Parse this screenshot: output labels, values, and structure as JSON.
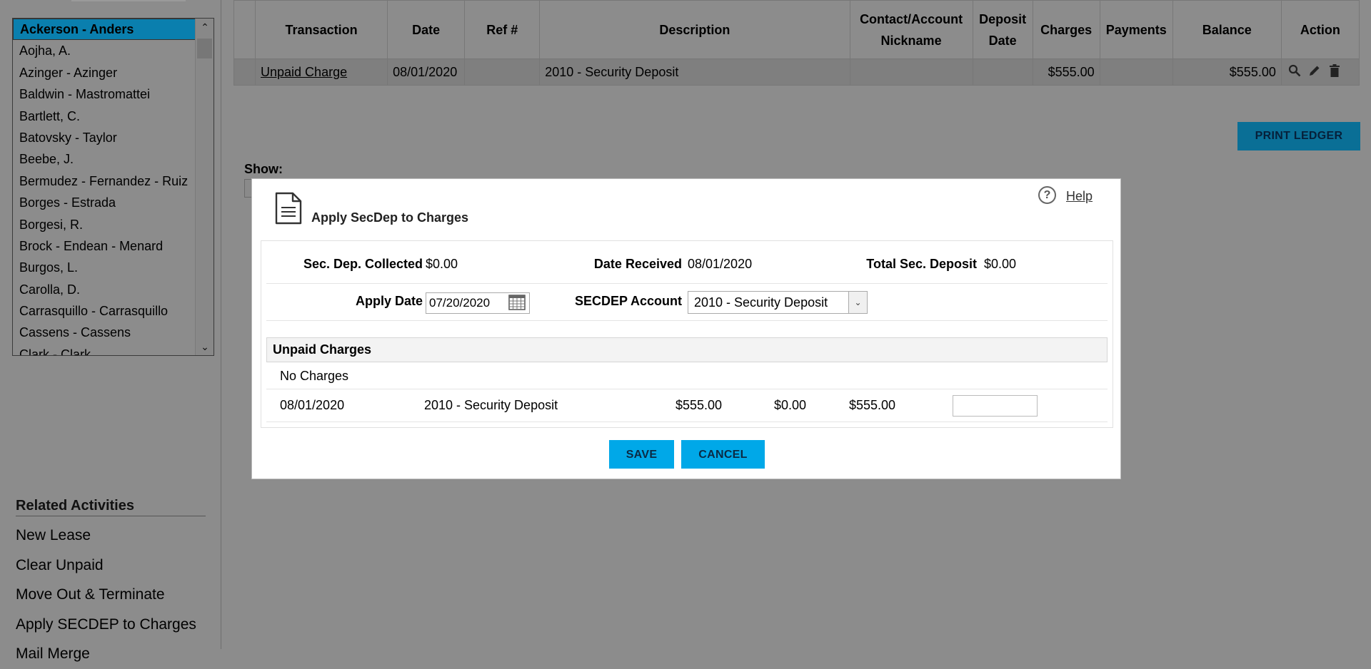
{
  "sidebar": {
    "tenants": [
      "Ackerson - Anders",
      "Aojha, A.",
      "Azinger - Azinger",
      "Baldwin - Mastromattei",
      "Bartlett, C.",
      "Batovsky - Taylor",
      "Beebe, J.",
      "Bermudez - Fernandez - Ruiz",
      "Borges - Estrada",
      "Borgesi, R.",
      "Brock - Endean - Menard",
      "Burgos, L.",
      "Carolla, D.",
      "Carrasquillo - Carrasquillo",
      "Cassens - Cassens",
      "Clark - Clark"
    ],
    "related_title": "Related Activities",
    "related_items": [
      "New Lease",
      "Clear Unpaid",
      "Move Out & Terminate",
      "Apply SECDEP to Charges",
      "Mail Merge"
    ]
  },
  "ledger": {
    "headers": [
      "",
      "Transaction",
      "Date",
      "Ref #",
      "Description",
      "Contact/Account Nickname",
      "Deposit Date",
      "Charges",
      "Payments",
      "Balance",
      "Action"
    ],
    "row": {
      "transaction": "Unpaid Charge",
      "date": "08/01/2020",
      "ref": "",
      "description": "2010 - Security Deposit",
      "nickname": "",
      "deposit_date": "",
      "charges": "$555.00",
      "payments": "",
      "balance": "$555.00",
      "actions": [
        "view-icon",
        "edit-icon",
        "delete-icon"
      ]
    },
    "print_label": "PRINT LEDGER",
    "show_label": "Show:"
  },
  "modal": {
    "title": "Apply SecDep to Charges",
    "help_label": "Help",
    "sec_dep_collected_label": "Sec. Dep. Collected",
    "sec_dep_collected_value": "$0.00",
    "date_received_label": "Date Received",
    "date_received_value": "08/01/2020",
    "total_sec_deposit_label": "Total Sec. Deposit",
    "total_sec_deposit_value": "$0.00",
    "apply_date_label": "Apply Date",
    "apply_date_value": "07/20/2020",
    "secdep_account_label": "SECDEP Account",
    "secdep_account_value": "2010 - Security Deposit",
    "unpaid_charges_title": "Unpaid Charges",
    "no_charges_text": "No Charges",
    "charge": {
      "date": "08/01/2020",
      "description": "2010 - Security Deposit",
      "amount": "$555.00",
      "paid": "$0.00",
      "balance": "$555.00",
      "apply_amount": ""
    },
    "save_label": "SAVE",
    "cancel_label": "CANCEL"
  },
  "colors": {
    "accent": "#00a8e8",
    "overlay": "#8c8c8c",
    "selected_row": "#0a7fae"
  }
}
